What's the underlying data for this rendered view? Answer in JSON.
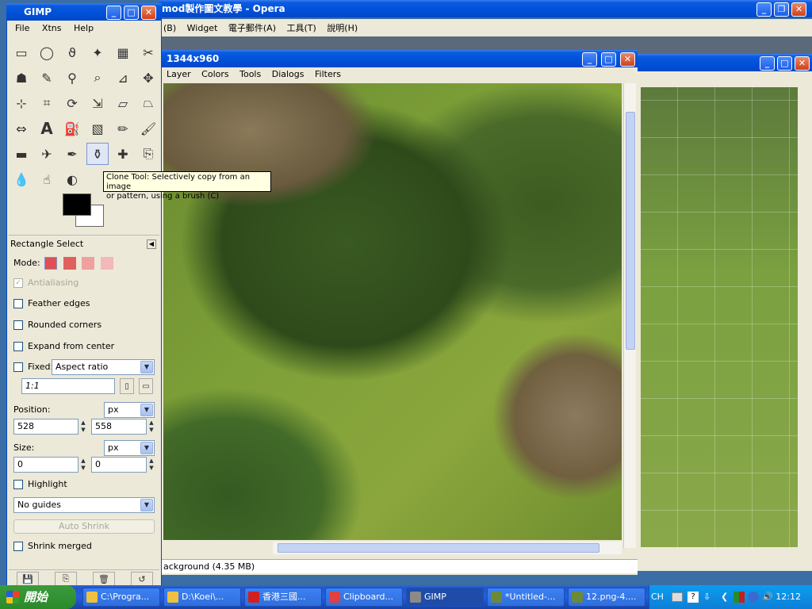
{
  "opera": {
    "title": "mod製作圖文教學 - Opera",
    "menu": [
      "(B)",
      "Widget",
      "電子郵件(A)",
      "工具(T)",
      "說明(H)"
    ]
  },
  "image_window": {
    "title": "1344x960",
    "menu": [
      "Layer",
      "Colors",
      "Tools",
      "Dialogs",
      "Filters"
    ],
    "status": "ackground (4.35 MB)"
  },
  "gimp": {
    "title": "GIMP",
    "menu": [
      "File",
      "Xtns",
      "Help"
    ],
    "tools": [
      "rect-select-icon",
      "ellipse-select-icon",
      "lasso-icon",
      "fuzzy-select-icon",
      "color-select-icon",
      "scissors-icon",
      "foreground-select-icon",
      "paths-icon",
      "color-picker-icon",
      "zoom-icon",
      "measure-icon",
      "move-icon",
      "align-icon",
      "crop-icon",
      "rotate-icon",
      "scale-icon",
      "shear-icon",
      "perspective-icon",
      "flip-icon",
      "text-icon",
      "bucket-fill-icon",
      "blend-icon",
      "pencil-icon",
      "paintbrush-icon",
      "eraser-icon",
      "airbrush-icon",
      "ink-icon",
      "clone-icon",
      "heal-icon",
      "perspective-clone-icon",
      "blur-icon",
      "smudge-icon",
      "dodge-burn-icon"
    ],
    "tooltip_line1": "Clone Tool: Selectively copy from an image",
    "tooltip_line2": "or pattern, using a brush  (C)",
    "options_title": "Rectangle Select",
    "mode_label": "Mode:",
    "antialiasing": "Antialiasing",
    "feather_edges": "Feather edges",
    "rounded_corners": "Rounded corners",
    "expand_from_center": "Expand from center",
    "fixed_label": "Fixed:",
    "fixed_value": "Aspect ratio",
    "ratio_value": "1:1",
    "position_label": "Position:",
    "position_unit": "px",
    "position_x": "528",
    "position_y": "558",
    "size_label": "Size:",
    "size_unit": "px",
    "size_w": "0",
    "size_h": "0",
    "highlight": "Highlight",
    "guides_value": "No guides",
    "auto_shrink": "Auto Shrink",
    "shrink_merged": "Shrink merged"
  },
  "taskbar": {
    "start": "開始",
    "tasks": [
      {
        "label": "C:\\Progra...",
        "color": "#f0c040"
      },
      {
        "label": "D:\\Koei\\...",
        "color": "#f0c040"
      },
      {
        "label": "香港三國...",
        "color": "#d02020"
      },
      {
        "label": "Clipboard...",
        "color": "#e04040"
      },
      {
        "label": "GIMP",
        "color": "#8a8a8a"
      },
      {
        "label": "*Untitled-...",
        "color": "#6a8a3a"
      },
      {
        "label": "12.png-4....",
        "color": "#6a8a3a"
      }
    ],
    "lang": "CH",
    "clock": "12:12"
  }
}
